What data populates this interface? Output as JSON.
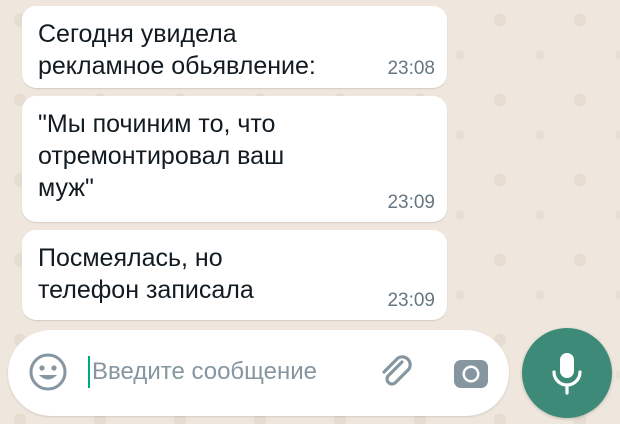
{
  "messages": [
    {
      "text": "Сегодня увидела\nрекламное обьявление:",
      "time": "23:08"
    },
    {
      "text": "\"Мы починим то, что\nотремонтировал ваш\nмуж\"",
      "time": "23:09"
    },
    {
      "text": "Посмеялась, но\nтелефон записала",
      "time": "23:09"
    }
  ],
  "composer": {
    "placeholder": "Введите сообщение",
    "value": "",
    "emoji_icon": "emoji-icon",
    "attach_icon": "paperclip-icon",
    "camera_icon": "camera-icon",
    "mic_icon": "microphone-icon"
  },
  "colors": {
    "background": "#efe7dd",
    "bubble": "#ffffff",
    "timestamp": "#667781",
    "placeholder": "#8696a0",
    "accent": "#3d8a78",
    "icon": "#8696a0"
  }
}
